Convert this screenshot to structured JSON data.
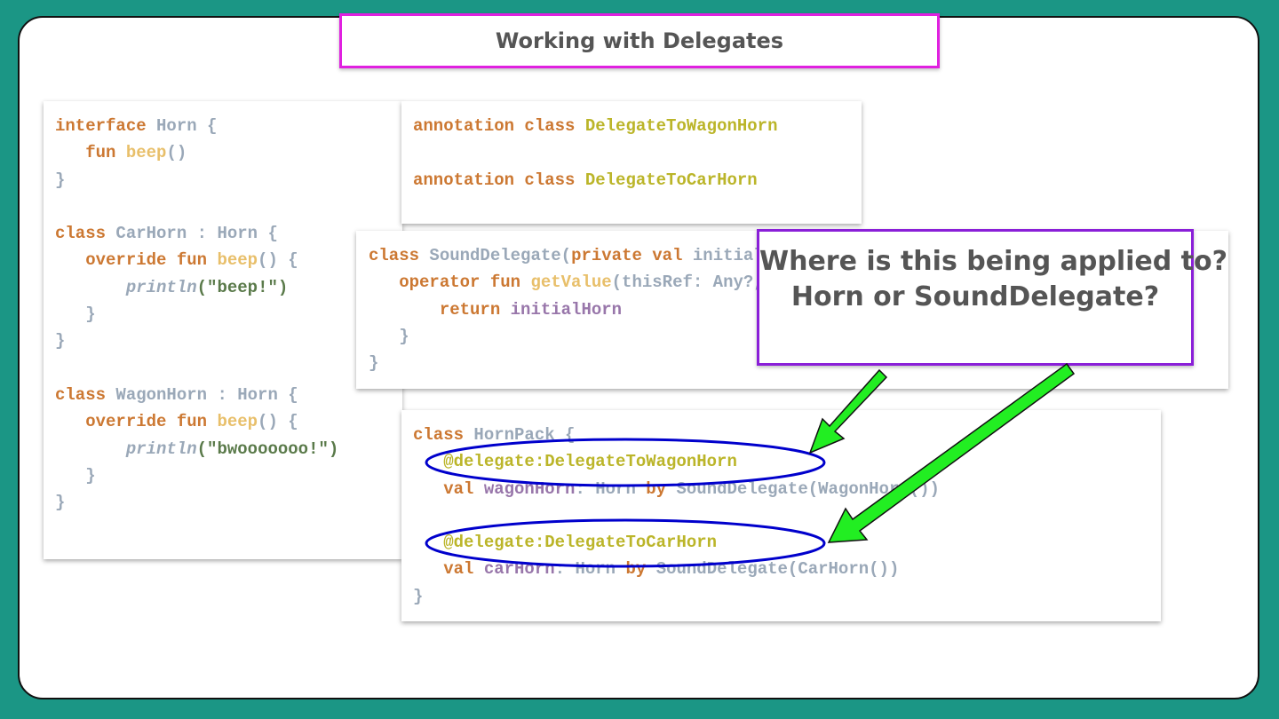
{
  "slide": {
    "title": "Working with Delegates"
  },
  "question": {
    "line1": "Where is this being applied to?",
    "line2": "Horn or SoundDelegate?"
  },
  "colors": {
    "background": "#1b9685",
    "title_border": "#e020e0",
    "question_border": "#8a1fd8",
    "ellipse": "#0000cc",
    "arrow": "#22ee22"
  },
  "code_horn": [
    [
      [
        "kw",
        "interface "
      ],
      [
        "ty",
        "Horn {"
      ]
    ],
    [
      [
        "kw",
        "   fun "
      ],
      [
        "fn",
        "beep"
      ],
      [
        "pn",
        "()"
      ]
    ],
    [
      [
        "pn",
        "}"
      ]
    ],
    [],
    [
      [
        "kw",
        "class "
      ],
      [
        "ty",
        "CarHorn : Horn {"
      ]
    ],
    [
      [
        "kw",
        "   override fun "
      ],
      [
        "fn",
        "beep"
      ],
      [
        "pn",
        "() {"
      ]
    ],
    [
      [
        "pn",
        "       "
      ],
      [
        "it",
        "println"
      ],
      [
        "st",
        "(\"beep!\")"
      ]
    ],
    [
      [
        "pn",
        "   }"
      ]
    ],
    [
      [
        "pn",
        "}"
      ]
    ],
    [],
    [
      [
        "kw",
        "class "
      ],
      [
        "ty",
        "WagonHorn : Horn {"
      ]
    ],
    [
      [
        "kw",
        "   override fun "
      ],
      [
        "fn",
        "beep"
      ],
      [
        "pn",
        "() {"
      ]
    ],
    [
      [
        "pn",
        "       "
      ],
      [
        "it",
        "println"
      ],
      [
        "st",
        "(\"bwooooooo!\")"
      ]
    ],
    [
      [
        "pn",
        "   }"
      ]
    ],
    [
      [
        "pn",
        "}"
      ]
    ]
  ],
  "code_annotations": [
    [
      [
        "kw",
        "annotation class "
      ],
      [
        "an",
        "DelegateToWagonHorn"
      ]
    ],
    [],
    [
      [
        "kw",
        "annotation class "
      ],
      [
        "an",
        "DelegateToCarHorn"
      ]
    ]
  ],
  "code_sound": [
    [
      [
        "kw",
        "class "
      ],
      [
        "ty",
        "SoundDelegate"
      ],
      [
        "pn",
        "("
      ],
      [
        "kw",
        "private val "
      ],
      [
        "ty",
        "initialHorn: Horn) {"
      ]
    ],
    [
      [
        "kw",
        "   operator fun "
      ],
      [
        "fn",
        "getValue"
      ],
      [
        "pn",
        "(thisRef: Any?, property: KProperty<*>): Horn {"
      ]
    ],
    [
      [
        "kw",
        "       return "
      ],
      [
        "pr",
        "initialHorn"
      ]
    ],
    [
      [
        "pn",
        "   }"
      ]
    ],
    [
      [
        "pn",
        "}"
      ]
    ]
  ],
  "code_pack": [
    [
      [
        "kw",
        "class "
      ],
      [
        "ty",
        "HornPack {"
      ]
    ],
    [
      [
        "an",
        "   @"
      ],
      [
        "an",
        "delegate:DelegateToWagonHorn"
      ]
    ],
    [
      [
        "kw",
        "   val "
      ],
      [
        "pr",
        "wagonHorn"
      ],
      [
        "pn",
        ": Horn "
      ],
      [
        "kw",
        "by "
      ],
      [
        "ty",
        "SoundDelegate(WagonHorn())"
      ]
    ],
    [],
    [
      [
        "an",
        "   @"
      ],
      [
        "an",
        "delegate:DelegateToCarHorn"
      ]
    ],
    [
      [
        "kw",
        "   val "
      ],
      [
        "pr",
        "carHorn"
      ],
      [
        "pn",
        ": Horn "
      ],
      [
        "kw",
        "by "
      ],
      [
        "ty",
        "SoundDelegate(CarHorn())"
      ]
    ],
    [
      [
        "pn",
        "}"
      ]
    ]
  ]
}
